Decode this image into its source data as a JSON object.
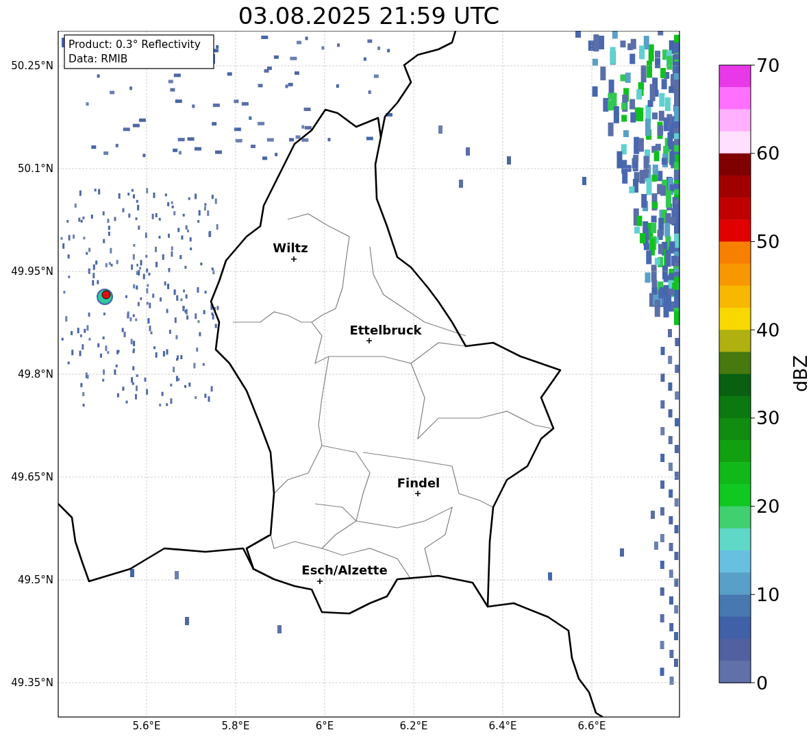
{
  "title": "03.08.2025 21:59 UTC",
  "legend": [
    "Product: 0.3° Reflectivity",
    "Data: RMIB"
  ],
  "map": {
    "lat_labels": [
      "50.25°N",
      "50.1°N",
      "49.95°N",
      "49.8°N",
      "49.65°N",
      "49.5°N",
      "49.35°N"
    ],
    "lon_labels": [
      "5.6°E",
      "5.8°E",
      "6°E",
      "6.2°E",
      "6.4°E",
      "6.6°E"
    ],
    "cities": [
      {
        "name": "Wiltz"
      },
      {
        "name": "Ettelbruck"
      },
      {
        "name": "Findel"
      },
      {
        "name": "Esch/Alzette"
      }
    ]
  },
  "colorbar": {
    "label": "dBZ",
    "ticks": [
      "70",
      "60",
      "50",
      "40",
      "30",
      "20",
      "10",
      "0"
    ],
    "segments": [
      {
        "color": "#e838e8"
      },
      {
        "color": "#ff70ff"
      },
      {
        "color": "#ffb0ff"
      },
      {
        "color": "#ffe0ff"
      },
      {
        "color": "#800000"
      },
      {
        "color": "#a00000"
      },
      {
        "color": "#c00000"
      },
      {
        "color": "#e00000"
      },
      {
        "color": "#f88000"
      },
      {
        "color": "#f89800"
      },
      {
        "color": "#f8b800"
      },
      {
        "color": "#f8d800"
      },
      {
        "color": "#b0b010"
      },
      {
        "color": "#487810"
      },
      {
        "color": "#086010"
      },
      {
        "color": "#0c7810"
      },
      {
        "color": "#108c10"
      },
      {
        "color": "#10a010"
      },
      {
        "color": "#10b818"
      },
      {
        "color": "#10c820"
      },
      {
        "color": "#40d070"
      },
      {
        "color": "#60d8c8"
      },
      {
        "color": "#68c0e0"
      },
      {
        "color": "#58a0c8"
      },
      {
        "color": "#4878b0"
      },
      {
        "color": "#4060a8"
      },
      {
        "color": "#5060a0"
      },
      {
        "color": "#6070a8"
      }
    ]
  }
}
